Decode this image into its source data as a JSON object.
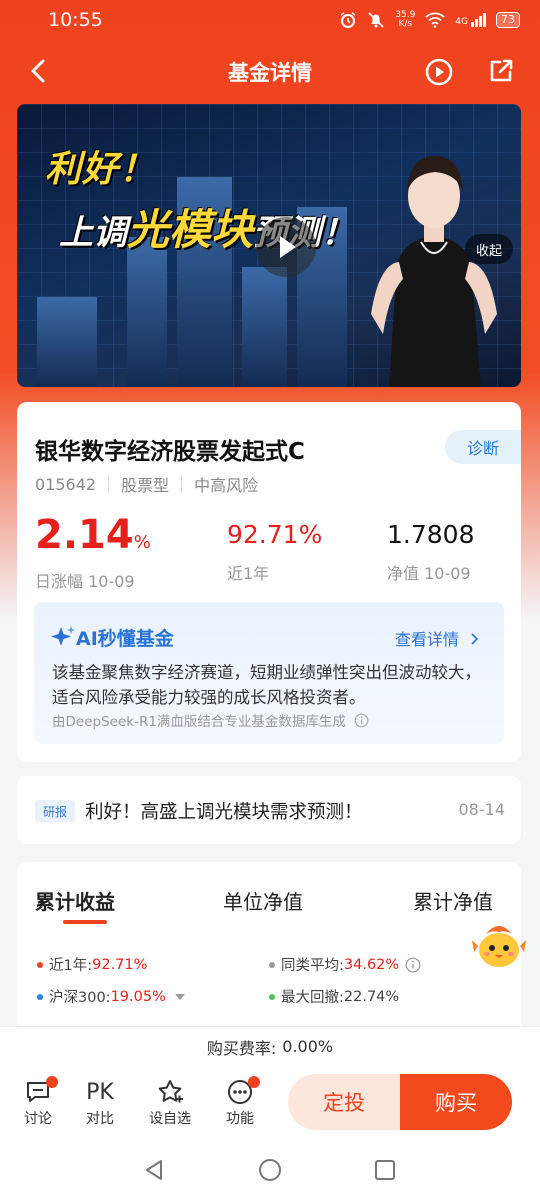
{
  "status_bar": {
    "time": "10:55",
    "net_speed_value": "35.9",
    "net_speed_unit": "K/s",
    "signal_label": "4G",
    "battery": "73"
  },
  "nav": {
    "title": "基金详情"
  },
  "video": {
    "headline_line1": "利好！",
    "headline_line2_pre": "上调",
    "headline_line2_highlight": "光模块",
    "headline_line2_post": "预测！",
    "collapse_label": "收起"
  },
  "fund": {
    "name": "银华数字经济股票发起式C",
    "diagnose_label": "诊断",
    "code": "015642",
    "type": "股票型",
    "risk": "中高风险",
    "daily_change": "2.14",
    "daily_change_unit": "%",
    "daily_change_label": "日涨幅 10-09",
    "one_year_return": "92.71%",
    "one_year_label": "近1年",
    "nav_value": "1.7808",
    "nav_label": "净值 10-09"
  },
  "ai": {
    "title": "AI秒懂基金",
    "detail_link": "查看详情",
    "summary": "该基金聚焦数字经济赛道，短期业绩弹性突出但波动较大，适合风险承受能力较强的成长风格投资者。",
    "source": "由DeepSeek-R1满血版结合专业基金数据库生成"
  },
  "news": {
    "tag": "研报",
    "title": "利好！高盛上调光模块需求预测！",
    "date": "08-14"
  },
  "performance": {
    "tabs": [
      "累计收益",
      "单位净值",
      "累计净值"
    ],
    "legend": [
      {
        "label": "近1年:",
        "value": "92.71%",
        "color": "#f0421e"
      },
      {
        "label": "同类平均:",
        "value": "34.62%",
        "color": "#999999"
      },
      {
        "label": "沪深300:",
        "value": "19.05%",
        "color": "#2a83e0"
      },
      {
        "label": "最大回撤:",
        "value": "22.74%",
        "color": "#4cc15a"
      }
    ]
  },
  "fee": {
    "label": "购买费率:",
    "value": "0.00%"
  },
  "bottom_bar": {
    "items": [
      {
        "label": "讨论",
        "icon": "chat-icon"
      },
      {
        "label": "对比",
        "icon_text": "PK"
      },
      {
        "label": "设自选",
        "icon": "star-add-icon"
      },
      {
        "label": "功能",
        "icon": "more-icon"
      }
    ],
    "dingtou_label": "定投",
    "buy_label": "购买"
  }
}
